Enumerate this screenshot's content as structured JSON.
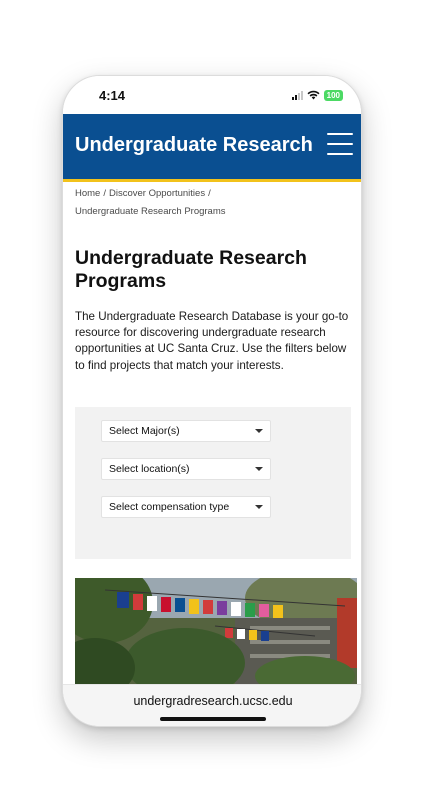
{
  "status_bar": {
    "time": "4:14",
    "battery": "100"
  },
  "header": {
    "title": "Undergraduate Research"
  },
  "breadcrumb": {
    "home": "Home",
    "discover": "Discover Opportunities",
    "current": "Undergraduate Research Programs",
    "separator": "/"
  },
  "main": {
    "title": "Undergraduate Research Programs",
    "intro": "The Undergraduate Research Database is your go-to resource for discovering undergraduate research opportunities at UC Santa Cruz. Use the filters below to find projects that match your interests."
  },
  "filters": {
    "major": "Select Major(s)",
    "location": "Select location(s)",
    "compensation": "Select compensation type"
  },
  "browser": {
    "url": "undergradresearch.ucsc.edu"
  },
  "colors": {
    "header_bg": "#0a4f91",
    "header_accent": "#f2c21b",
    "filter_panel_bg": "#f2f2f2"
  }
}
